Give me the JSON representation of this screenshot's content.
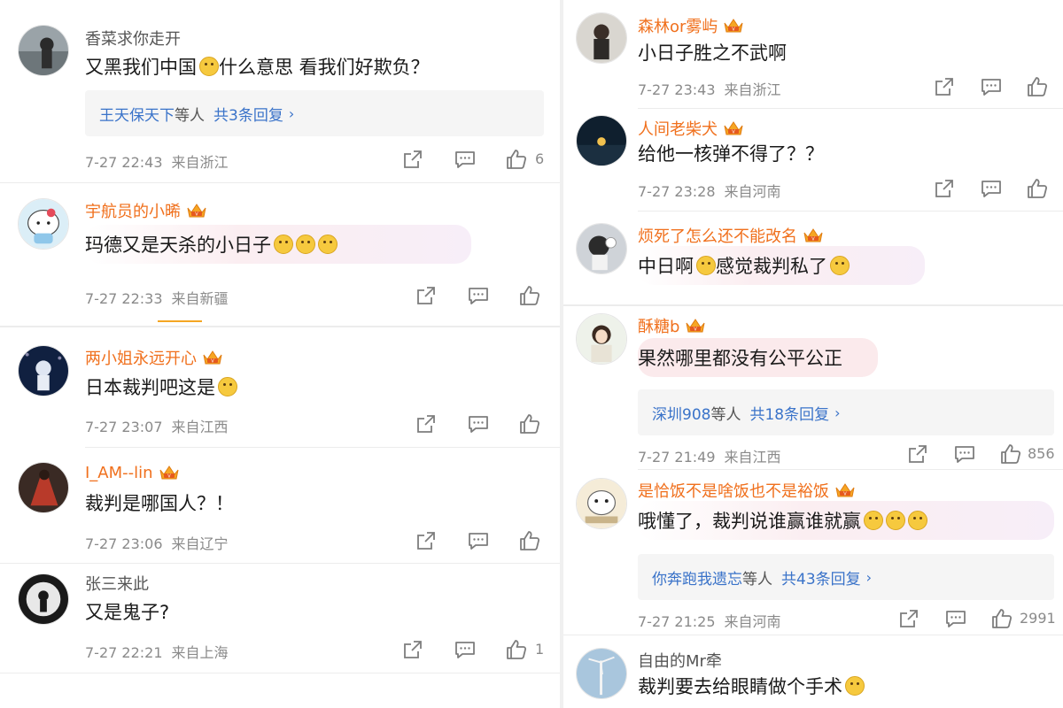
{
  "left": [
    {
      "user": "香菜求你走开",
      "vip": false,
      "text": "又黑我们中国",
      "text2": " 什么意思 看我们好欺负？",
      "replies": {
        "names": "王天保天下",
        "suffix": "等人",
        "count": "共3条回复"
      },
      "date": "7-27 22:43",
      "location": "来自浙江",
      "likes": "6"
    },
    {
      "user": "宇航员的小晞",
      "vip": true,
      "text": "玛德又是天杀的小日子",
      "text2": "",
      "date": "7-27 22:33",
      "location": "来自新疆",
      "likes": ""
    },
    {
      "user": "两小姐永远开心",
      "vip": true,
      "text": "日本裁判吧这是",
      "text2": "",
      "date": "7-27 23:07",
      "location": "来自江西",
      "likes": ""
    },
    {
      "user": "I_AM--lin",
      "vip": true,
      "text": "裁判是哪国人？！",
      "text2": "",
      "date": "7-27 23:06",
      "location": "来自辽宁",
      "likes": ""
    },
    {
      "user": "张三来此",
      "vip": false,
      "text": "又是鬼子?",
      "text2": "",
      "date": "7-27 22:21",
      "location": "来自上海",
      "likes": "1"
    }
  ],
  "right": [
    {
      "user": "森林or雾屿",
      "vip": true,
      "text": "小日子胜之不武啊",
      "date": "7-27 23:43",
      "location": "来自浙江",
      "likes": ""
    },
    {
      "user": "人间老柴犬",
      "vip": true,
      "text": "给他一核弹不得了？？",
      "date": "7-27 23:28",
      "location": "来自河南",
      "likes": ""
    },
    {
      "user": "烦死了怎么还不能改名",
      "vip": true,
      "text": "中日啊",
      "text2": "感觉裁判私了",
      "date": "",
      "location": "",
      "likes": ""
    },
    {
      "user": "酥糖b",
      "vip": true,
      "text": "果然哪里都没有公平公正",
      "replies": {
        "names": "深圳908",
        "suffix": "等人",
        "count": "共18条回复"
      },
      "date": "7-27 21:49",
      "location": "来自江西",
      "likes": "856"
    },
    {
      "user": "是恰饭不是啥饭也不是裕饭",
      "vip": true,
      "text": "哦懂了，裁判说谁赢谁就赢",
      "replies": {
        "names": "你奔跑我遗忘",
        "suffix": "等人",
        "count": "共43条回复"
      },
      "date": "7-27 21:25",
      "location": "来自河南",
      "likes": "2991"
    },
    {
      "user": "自由的Mr牵",
      "vip": false,
      "text": "裁判要去给眼睛做个手术",
      "date": "",
      "location": "",
      "likes": ""
    }
  ],
  "icons": {
    "share": "share-icon",
    "comment": "comment-icon",
    "like": "thumbs-up-icon",
    "vip": "crown-badge-icon",
    "chevron": "chevron-right-icon"
  },
  "colors": {
    "vip_name": "#f0701d",
    "link": "#3a73c9",
    "meta": "#8a8a8a"
  }
}
